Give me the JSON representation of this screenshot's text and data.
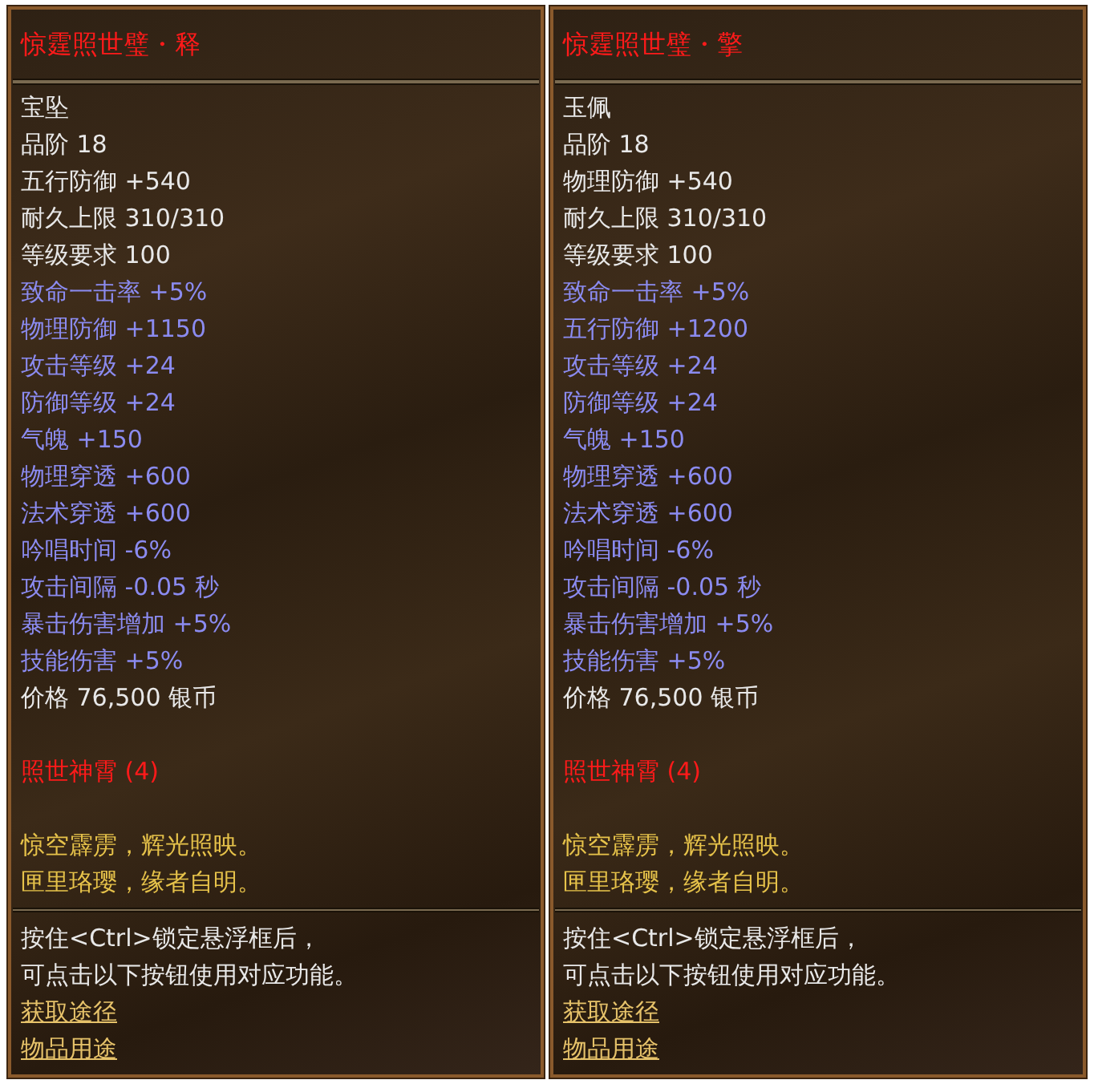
{
  "tooltips": [
    {
      "title": "惊霆照世璧・释",
      "item_type": "宝坠",
      "stats": [
        {
          "text": "品阶 18",
          "kind": "base"
        },
        {
          "text": "五行防御 +540",
          "kind": "base"
        },
        {
          "text": "耐久上限 310/310",
          "kind": "base"
        },
        {
          "text": "等级要求 100",
          "kind": "base"
        },
        {
          "text": "致命一击率 +5%",
          "kind": "bonus"
        },
        {
          "text": "物理防御 +1150",
          "kind": "bonus"
        },
        {
          "text": "攻击等级 +24",
          "kind": "bonus"
        },
        {
          "text": "防御等级 +24",
          "kind": "bonus"
        },
        {
          "text": "气魄 +150",
          "kind": "bonus"
        },
        {
          "text": "物理穿透 +600",
          "kind": "bonus"
        },
        {
          "text": "法术穿透 +600",
          "kind": "bonus"
        },
        {
          "text": "吟唱时间 -6%",
          "kind": "bonus"
        },
        {
          "text": "攻击间隔 -0.05 秒",
          "kind": "bonus"
        },
        {
          "text": "暴击伤害增加 +5%",
          "kind": "bonus"
        },
        {
          "text": "技能伤害 +5%",
          "kind": "bonus"
        },
        {
          "text": "价格 76,500 银币",
          "kind": "base"
        }
      ],
      "set_name": "照世神霄 (4)",
      "flavor": [
        "惊空霹雳，辉光照映。",
        "匣里珞璎，缘者自明。"
      ],
      "hint": [
        "按住<Ctrl>锁定悬浮框后，",
        "可点击以下按钮使用对应功能。"
      ],
      "links": [
        "获取途径",
        "物品用途"
      ]
    },
    {
      "title": "惊霆照世璧・擎",
      "item_type": "玉佩",
      "stats": [
        {
          "text": "品阶 18",
          "kind": "base"
        },
        {
          "text": "物理防御 +540",
          "kind": "base"
        },
        {
          "text": "耐久上限 310/310",
          "kind": "base"
        },
        {
          "text": "等级要求 100",
          "kind": "base"
        },
        {
          "text": "致命一击率 +5%",
          "kind": "bonus"
        },
        {
          "text": "五行防御 +1200",
          "kind": "bonus"
        },
        {
          "text": "攻击等级 +24",
          "kind": "bonus"
        },
        {
          "text": "防御等级 +24",
          "kind": "bonus"
        },
        {
          "text": "气魄 +150",
          "kind": "bonus"
        },
        {
          "text": "物理穿透 +600",
          "kind": "bonus"
        },
        {
          "text": "法术穿透 +600",
          "kind": "bonus"
        },
        {
          "text": "吟唱时间 -6%",
          "kind": "bonus"
        },
        {
          "text": "攻击间隔 -0.05 秒",
          "kind": "bonus"
        },
        {
          "text": "暴击伤害增加 +5%",
          "kind": "bonus"
        },
        {
          "text": "技能伤害 +5%",
          "kind": "bonus"
        },
        {
          "text": "价格 76,500 银币",
          "kind": "base"
        }
      ],
      "set_name": "照世神霄 (4)",
      "flavor": [
        "惊空霹雳，辉光照映。",
        "匣里珞璎，缘者自明。"
      ],
      "hint": [
        "按住<Ctrl>锁定悬浮框后，",
        "可点击以下按钮使用对应功能。"
      ],
      "links": [
        "获取途径",
        "物品用途"
      ]
    }
  ]
}
